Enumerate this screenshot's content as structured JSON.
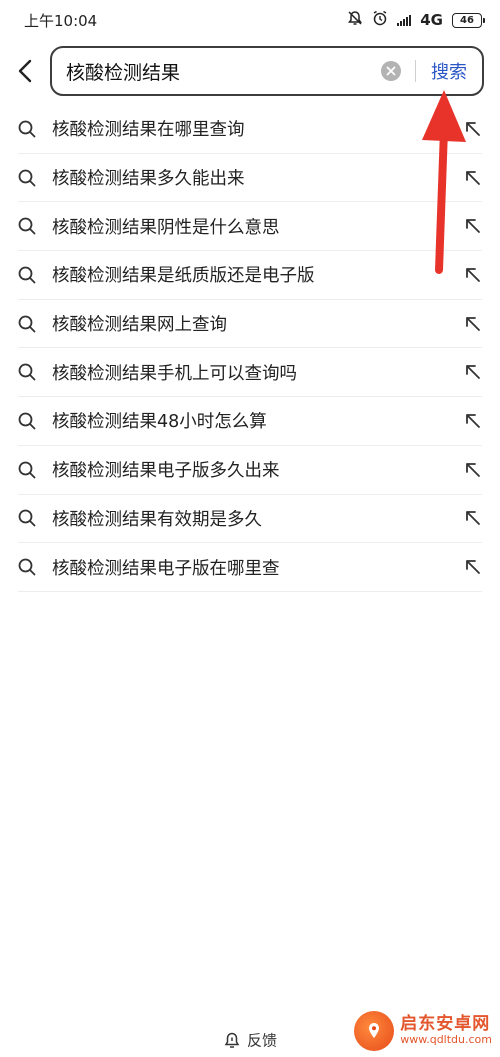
{
  "status_bar": {
    "time": "上午10:04",
    "network": "4G",
    "battery": "46"
  },
  "search": {
    "query": "核酸检测结果",
    "submit_label": "搜索"
  },
  "suggestions": [
    "核酸检测结果在哪里查询",
    "核酸检测结果多久能出来",
    "核酸检测结果阴性是什么意思",
    "核酸检测结果是纸质版还是电子版",
    "核酸检测结果网上查询",
    "核酸检测结果手机上可以查询吗",
    "核酸检测结果48小时怎么算",
    "核酸检测结果电子版多久出来",
    "核酸检测结果有效期是多久",
    "核酸检测结果电子版在哪里查"
  ],
  "footer": {
    "feedback_label": "反馈"
  },
  "watermark": {
    "title": "启东安卓网",
    "url": "www.qdltdu.com"
  },
  "colors": {
    "accent_blue": "#2a56c6",
    "annotation_red": "#e8332b"
  }
}
